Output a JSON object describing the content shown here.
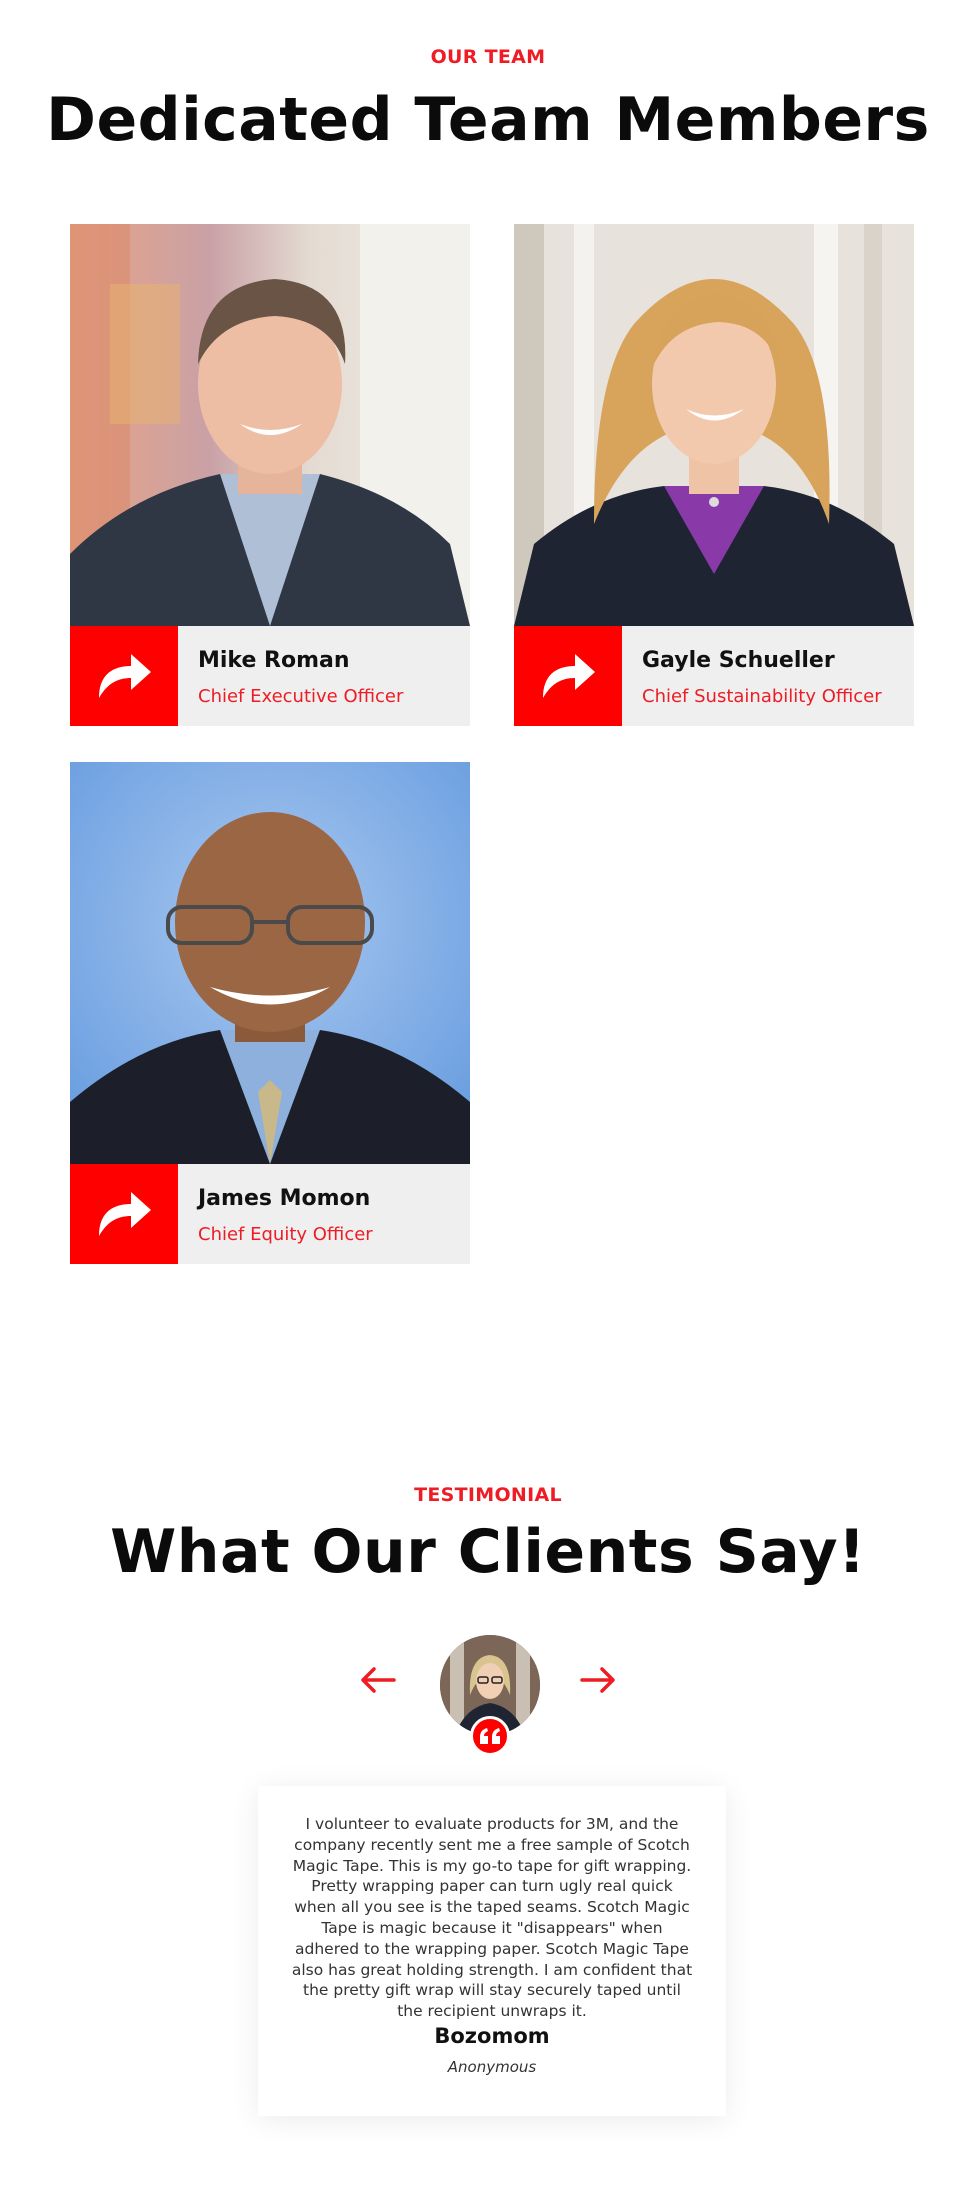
{
  "team": {
    "eyebrow": "OUR TEAM",
    "title": "Dedicated Team Members",
    "members": [
      {
        "name": "Mike Roman",
        "role": "Chief Executive Officer"
      },
      {
        "name": "Gayle Schueller",
        "role": "Chief Sustainability Officer"
      },
      {
        "name": "James Momon",
        "role": "Chief Equity Officer"
      }
    ]
  },
  "testimonial": {
    "eyebrow": "TESTIMONIAL",
    "title": "What Our Clients Say!",
    "quote": "I volunteer to evaluate products for 3M, and the company recently sent me a free sample of Scotch Magic Tape. This is my go-to tape for gift wrapping. Pretty wrapping paper can turn ugly real quick when all you see is the taped seams. Scotch Magic Tape is magic because it \"disappears\" when adhered to the wrapping paper. Scotch Magic Tape also has great holding strength. I am confident that the pretty gift wrap will stay securely taped until the recipient unwraps it.",
    "client_name": "Bozomom",
    "client_title": "Anonymous"
  },
  "colors": {
    "accent": "#ff0000",
    "bar_bg": "#efefef"
  },
  "icons": {
    "share": "share-arrow-icon",
    "prev": "arrow-left-icon",
    "next": "arrow-right-icon",
    "quote": "quote-icon"
  }
}
